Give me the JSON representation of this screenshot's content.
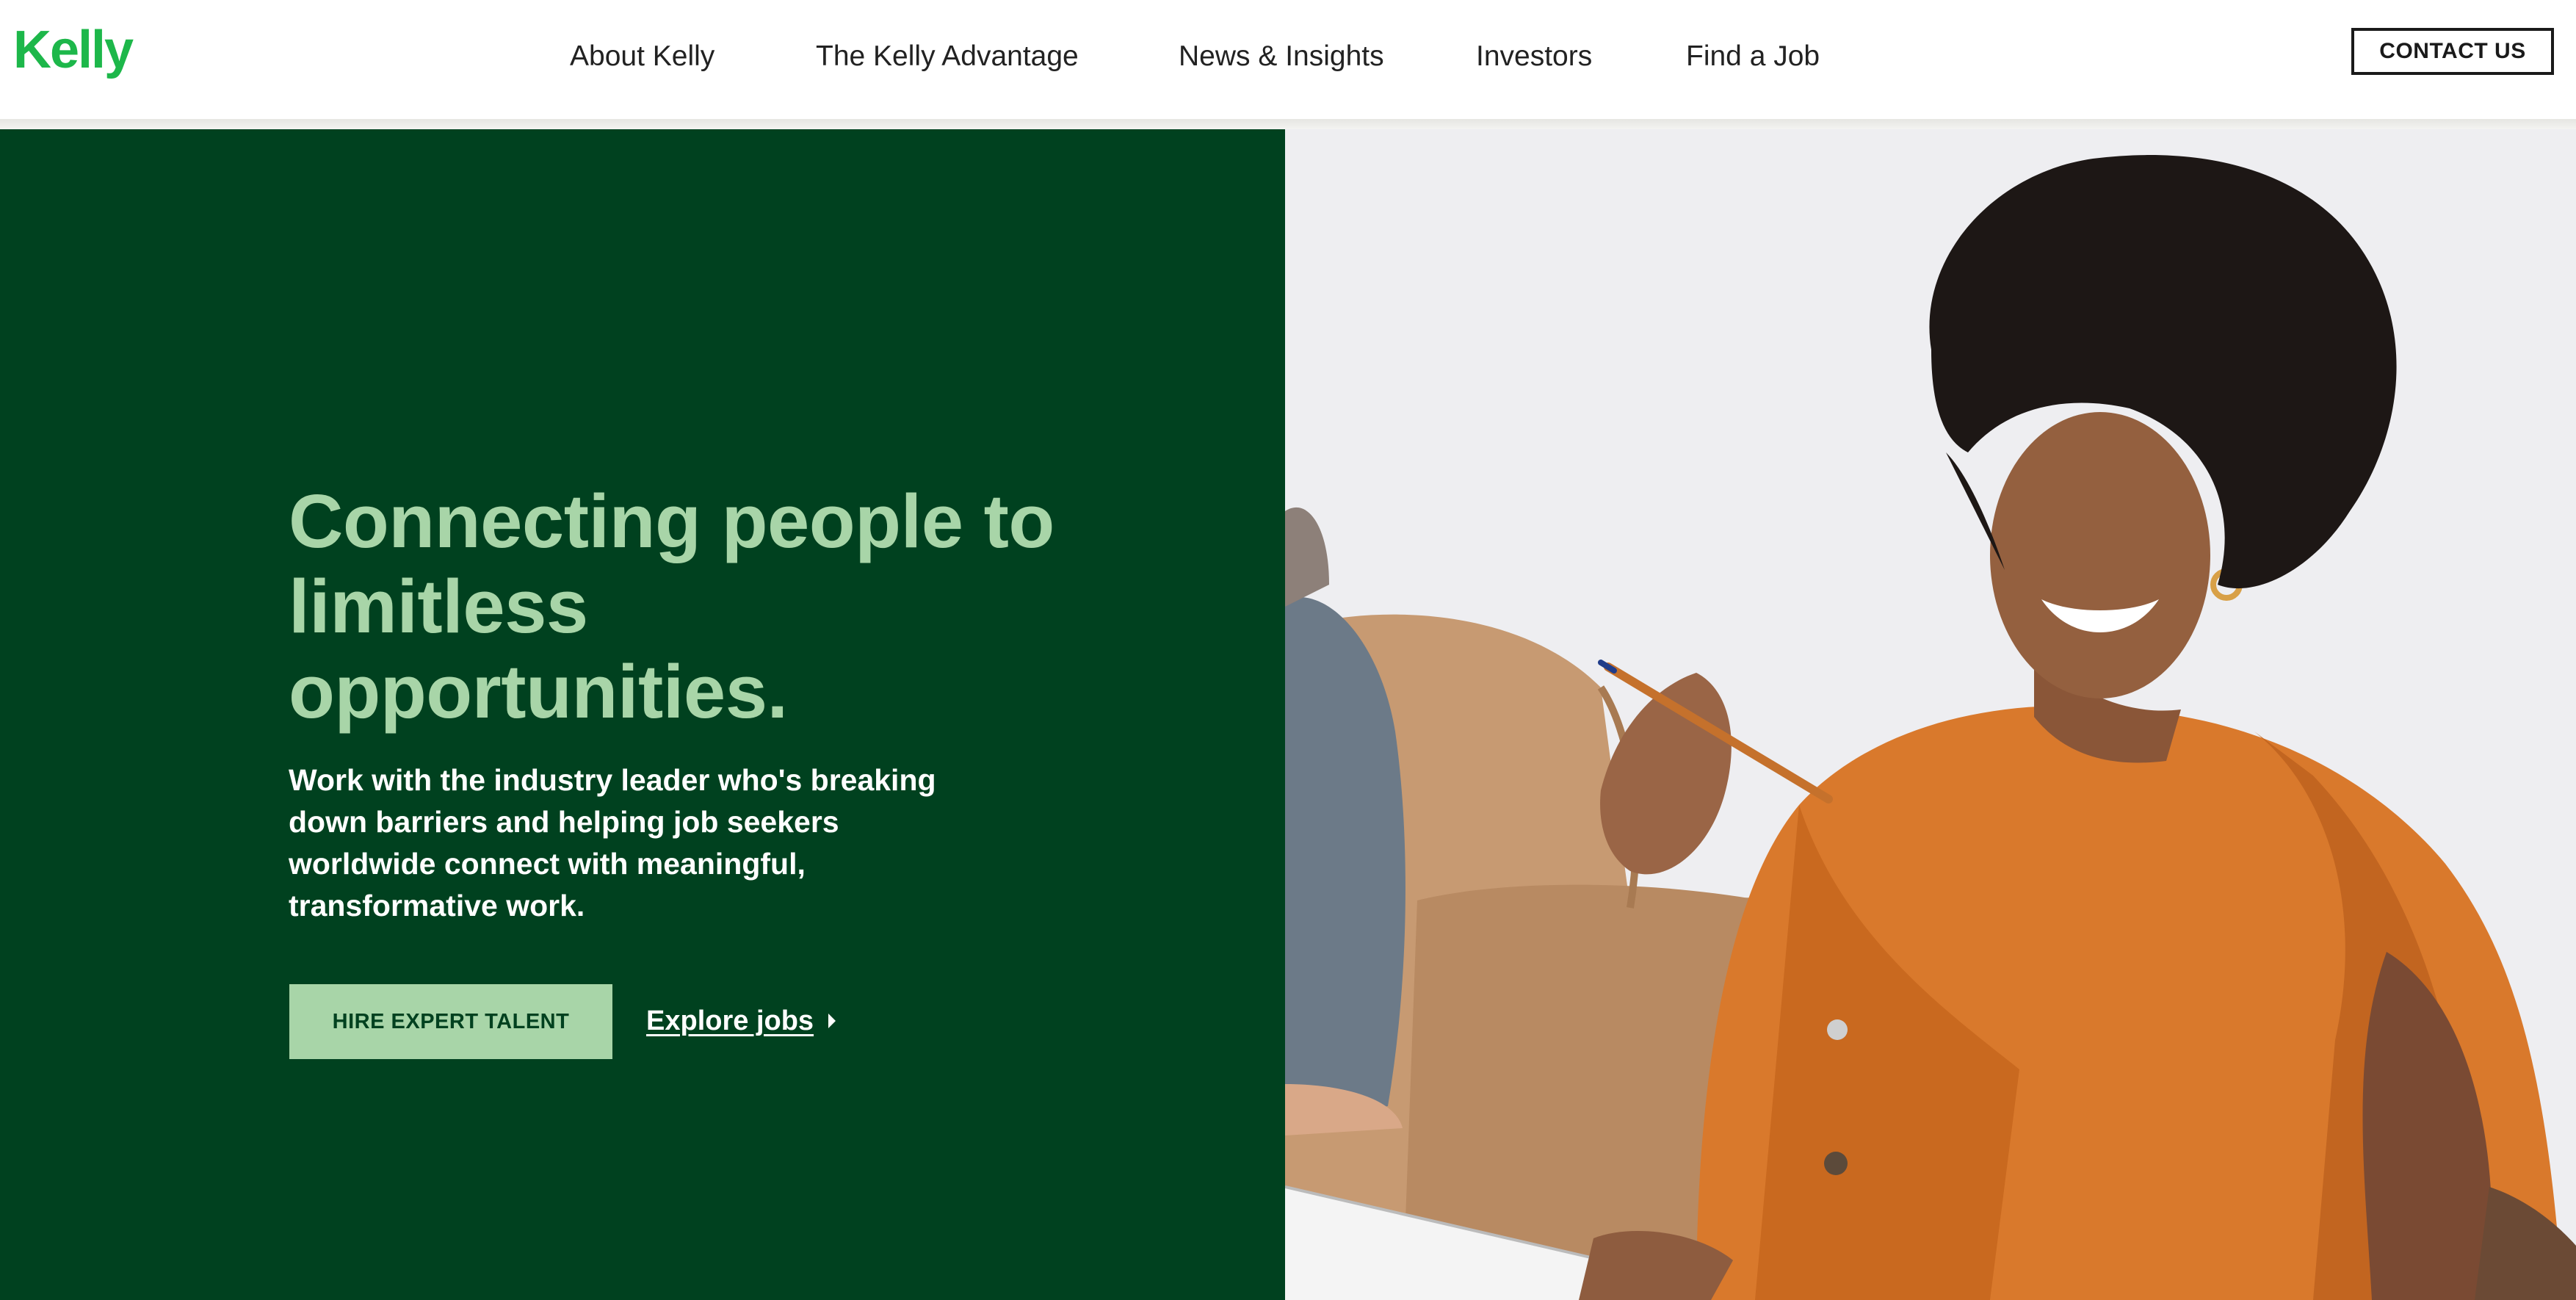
{
  "header": {
    "logo_text": "Kelly",
    "nav": [
      {
        "label": "About Kelly"
      },
      {
        "label": "The Kelly Advantage"
      },
      {
        "label": "News & Insights"
      },
      {
        "label": "Investors"
      },
      {
        "label": "Find a Job"
      }
    ],
    "contact_label": "CONTACT US"
  },
  "hero": {
    "title": "Connecting people to limitless opportunities.",
    "subtitle": "Work with the industry leader who's breaking down barriers and helping job seekers worldwide connect with meaningful, transformative work.",
    "primary_cta": "HIRE EXPERT TALENT",
    "secondary_cta": "Explore jobs",
    "image_subject": "smiling woman in orange shirt holding a pen and notebook"
  },
  "colors": {
    "brand_green": "#1db74a",
    "hero_background": "#00411f",
    "hero_title": "#a8d5a8",
    "primary_button": "#a8d5a8"
  },
  "icons": {
    "explore_caret": "caret-right-icon"
  }
}
